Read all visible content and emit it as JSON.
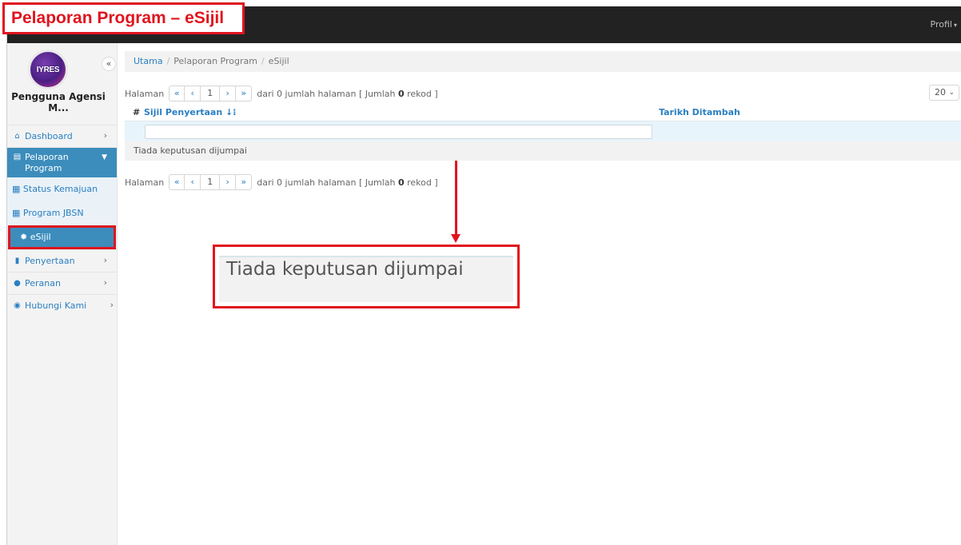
{
  "annotation": {
    "title": "Pelaporan Program – eSijil",
    "zoom_text": "Tiada keputusan dijumpai"
  },
  "topbar": {
    "profile_label": "Profil",
    "profile_caret": "▾"
  },
  "sidebar": {
    "logo_text": "IYRES",
    "collapse_label": "«",
    "user_name": "Pengguna Agensi M...",
    "items": [
      {
        "label": "Dashboard",
        "icon": "home-icon"
      },
      {
        "label": "Pelaporan Program",
        "icon": "book-icon",
        "expanded": true
      },
      {
        "label": "Penyertaan",
        "icon": "clipboard-icon"
      },
      {
        "label": "Peranan",
        "icon": "user-icon"
      },
      {
        "label": "Hubungi Kami",
        "icon": "comment-icon"
      }
    ],
    "subitems": [
      {
        "label": "Status Kemajuan",
        "icon": "table-icon"
      },
      {
        "label": "Program JBSN",
        "icon": "table-icon"
      },
      {
        "label": "eSijil",
        "icon": "certificate-icon",
        "active": true
      }
    ]
  },
  "breadcrumb": {
    "home": "Utama",
    "section": "Pelaporan Program",
    "current": "eSijil"
  },
  "pager": {
    "label": "Halaman",
    "first": "«",
    "prev": "‹",
    "page": "1",
    "next": "›",
    "last": "»",
    "info_prefix": "dari 0 jumlah halaman [ Jumlah ",
    "total": "0",
    "info_suffix": " rekod ]",
    "page_size": "20"
  },
  "table": {
    "hash": "#",
    "col1": "Sijil Penyertaan",
    "col1_sort_icon": "↓⁝",
    "col2": "Tarikh Ditambah",
    "filter_value": "",
    "empty_message": "Tiada keputusan dijumpai"
  },
  "colors": {
    "accent": "#3c8dbc",
    "link": "#2b7fc1",
    "annotation": "#e0141e",
    "topbar": "#222222"
  }
}
